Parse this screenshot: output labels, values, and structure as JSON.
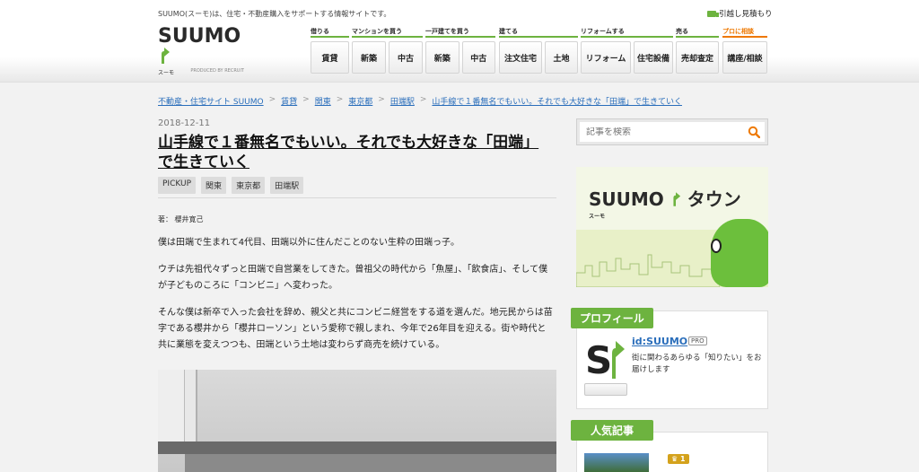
{
  "header": {
    "tagline": "SUUMO(スーモ)は、住宅・不動産購入をサポートする情報サイトです。",
    "moving_link": "引越し見積もり",
    "logo_text": "SUUMO",
    "logo_sub": "スーモ",
    "logo_credit": "PRODUCED BY RECRUIT",
    "nav_groups": [
      {
        "label": "借りる",
        "buttons": [
          "賃貸"
        ]
      },
      {
        "label": "マンションを買う",
        "buttons": [
          "新築",
          "中古"
        ]
      },
      {
        "label": "一戸建てを買う",
        "buttons": [
          "新築",
          "中古"
        ]
      },
      {
        "label": "建てる",
        "buttons": [
          "注文住宅",
          "土地"
        ]
      },
      {
        "label": "リフォームする",
        "buttons": [
          "リフォーム",
          "住宅設備"
        ]
      },
      {
        "label": "売る",
        "buttons": [
          "売却査定"
        ]
      },
      {
        "label": "プロに相談",
        "buttons": [
          "講座/相談"
        ]
      }
    ]
  },
  "breadcrumb": [
    "不動産・住宅サイト SUUMO",
    "賃貸",
    "関東",
    "東京都",
    "田端駅",
    "山手線で１番無名でもいい。それでも大好きな「田端」で生きていく"
  ],
  "article": {
    "date": "2018-12-11",
    "title": "山手線で１番無名でもいい。それでも大好きな「田端」で生きていく",
    "tags": [
      "PICKUP",
      "関東",
      "東京都",
      "田端駅"
    ],
    "author": "著： 櫻井寛己",
    "paragraphs": [
      "僕は田端で生まれて4代目、田端以外に住んだことのない生粋の田端っ子。",
      "ウチは先祖代々ずっと田端で自営業をしてきた。曾祖父の時代から「魚屋」、「飲食店」、そして僕が子どものころに「コンビニ」へ変わった。",
      "そんな僕は新卒で入った会社を辞め、親父と共にコンビニ経営をする道を選んだ。地元民からは苗字である櫻井から「櫻井ローソン」という愛称で親しまれ、今年で26年目を迎える。街や時代と共に業態を変えつつも、田端という土地は変わらず商売を続けている。"
    ]
  },
  "sidebar": {
    "search_placeholder": "記事を検索",
    "banner": {
      "logo": "SUUMO",
      "town": "タウン",
      "sub": "スーモ"
    },
    "profile": {
      "heading": "プロフィール",
      "name": "id:SUUMO",
      "badge": "PRO",
      "description": "街に関わるあらゆる「知りたい」をお届けします"
    },
    "popular": {
      "heading": "人気記事",
      "rank": "1"
    }
  },
  "colors": {
    "accent": "#6db33f",
    "orange": "#ee7800",
    "link": "#2a6ebb"
  }
}
